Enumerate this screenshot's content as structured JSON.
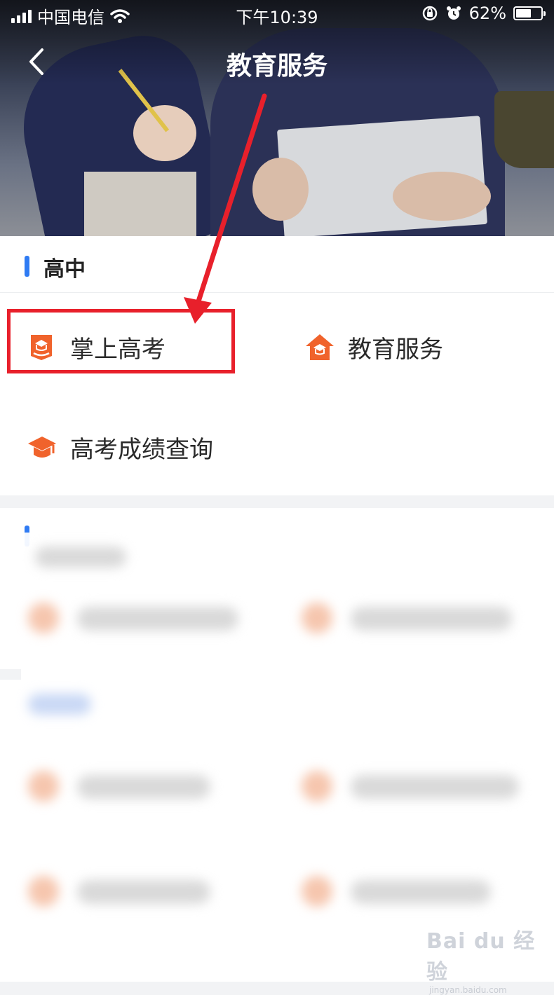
{
  "status_bar": {
    "carrier": "中国电信",
    "time": "下午10:39",
    "battery": "62%",
    "battery_level": 0.62
  },
  "navbar": {
    "title": "教育服务",
    "back_icon": "chevron-left-icon"
  },
  "sections": [
    {
      "title": "高中",
      "items": [
        {
          "label": "掌上高考",
          "icon": "book-cap-icon",
          "color": "#f0632c"
        },
        {
          "label": "教育服务",
          "icon": "house-cap-icon",
          "color": "#f0632c"
        },
        {
          "label": "高考成绩查询",
          "icon": "graduation-cap-icon",
          "color": "#f0632c"
        }
      ]
    }
  ],
  "colors": {
    "accent_bar": "#2f7bf3",
    "icon_orange": "#f0632c",
    "annotation_red": "#e8202b"
  },
  "watermark": {
    "text": "Bai du 经验",
    "sub": "jingyan.baidu.com"
  }
}
